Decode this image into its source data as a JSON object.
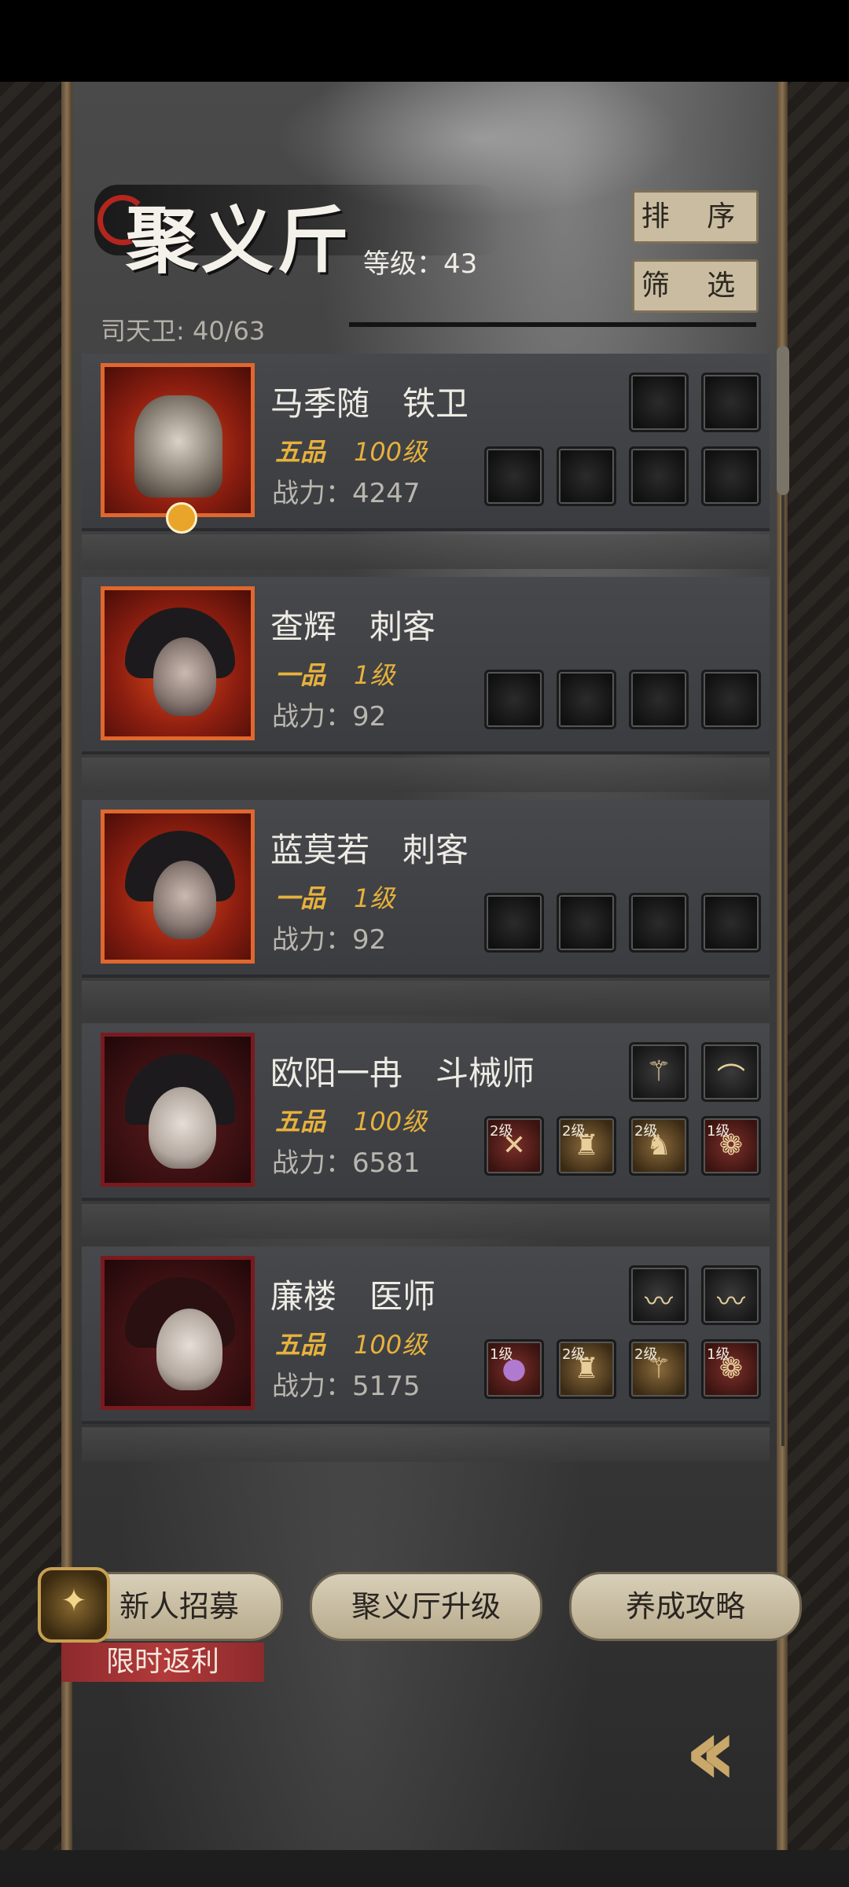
{
  "header": {
    "title": "聚义斤",
    "level_label": "等级：43",
    "sort_button": "排 序",
    "filter_button": "筛 选",
    "capacity": "司天卫: 40/63"
  },
  "heroes": [
    {
      "name": "马季随　铁卫",
      "grade": "五品",
      "level": "100级",
      "power": "战力：4247",
      "top_slots": [
        "",
        ""
      ],
      "bottom_slots": [
        "",
        "",
        "",
        ""
      ]
    },
    {
      "name": "查辉　刺客",
      "grade": "一品",
      "level": "1级",
      "power": "战力：92",
      "top_slots": [],
      "bottom_slots": [
        "",
        "",
        "",
        ""
      ]
    },
    {
      "name": "蓝莫若　刺客",
      "grade": "一品",
      "level": "1级",
      "power": "战力：92",
      "top_slots": [],
      "bottom_slots": [
        "",
        "",
        "",
        ""
      ]
    },
    {
      "name": "欧阳一冉　斗械师",
      "grade": "五品",
      "level": "100级",
      "power": "战力：6581",
      "top_slots": [
        "",
        ""
      ],
      "bottom_slots": [
        "2级",
        "2级",
        "2级",
        "1级"
      ]
    },
    {
      "name": "廉楼　医师",
      "grade": "五品",
      "level": "100级",
      "power": "战力：5175",
      "top_slots": [
        "",
        ""
      ],
      "bottom_slots": [
        "1级",
        "2级",
        "2级",
        "1级"
      ]
    }
  ],
  "bottom_bar": {
    "recruit": "新人招募",
    "upgrade": "聚义厅升级",
    "guide": "养成攻略",
    "promo": "限时返利"
  },
  "icons": {
    "back": "double-chevron-left-icon"
  }
}
